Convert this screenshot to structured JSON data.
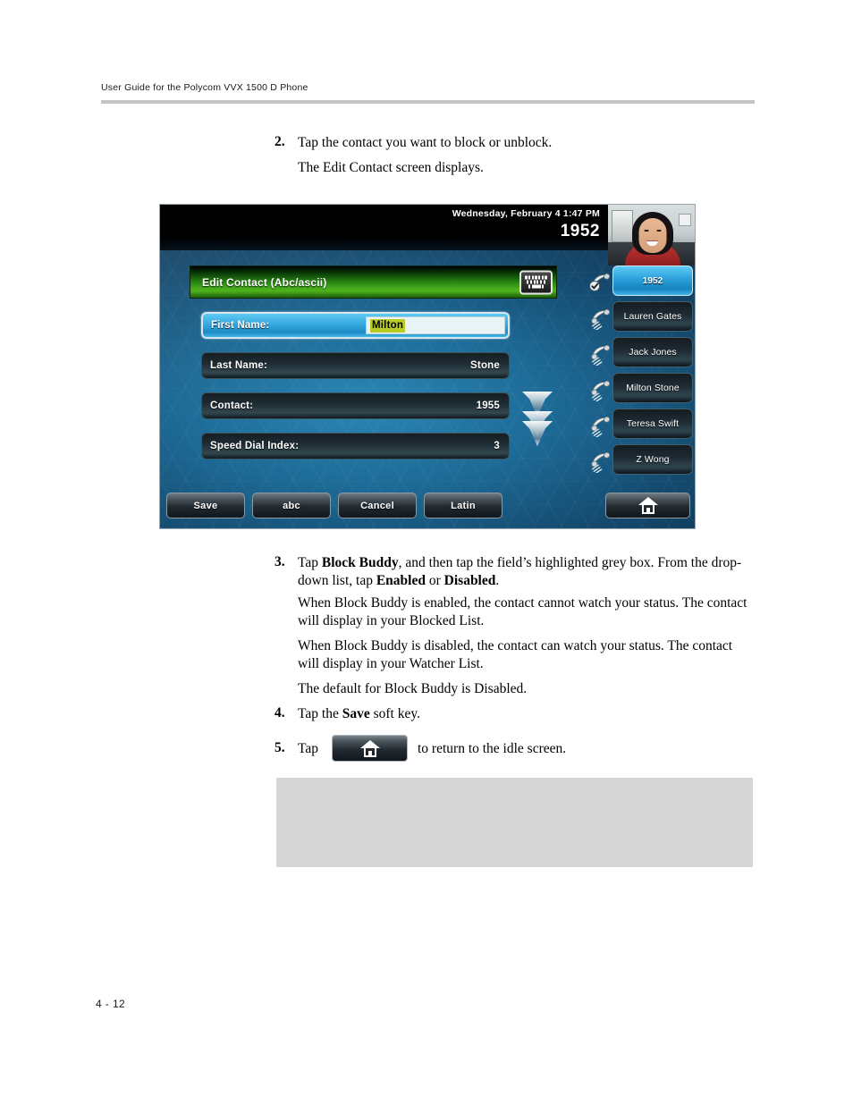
{
  "document": {
    "running_header": "User Guide for the Polycom VVX 1500 D Phone",
    "page_number": "4 - 12"
  },
  "steps": {
    "step2": {
      "number": "2.",
      "line1": "Tap the contact you want to block or unblock.",
      "line2": "The Edit Contact screen displays."
    },
    "step3": {
      "number": "3.",
      "text_a": "Tap ",
      "bold_a": "Block Buddy",
      "text_b": ", and then tap the field’s highlighted grey box. From the drop-down list, tap ",
      "bold_b": "Enabled",
      "text_c": " or ",
      "bold_c": "Disabled",
      "text_d": ".",
      "para1": "When Block Buddy is enabled, the contact cannot watch your status. The contact will display in your Blocked List.",
      "para2": "When Block Buddy is disabled, the contact can watch your status. The contact will display in your Watcher List.",
      "para3": "The default for Block Buddy is Disabled."
    },
    "step4": {
      "number": "4.",
      "text_a": "Tap the ",
      "bold_a": "Save",
      "text_b": " soft key."
    },
    "step5": {
      "number": "5.",
      "text_a": "Tap",
      "text_b": "to return to the idle screen.",
      "button_icon": "home-icon"
    }
  },
  "phone": {
    "status_bar": {
      "datetime": "Wednesday, February 4  1:47 PM",
      "extension": "1952"
    },
    "video_preview": {
      "icon": "video-self-view"
    },
    "title_bar": {
      "title": "Edit Contact (Abc/ascii)",
      "keyboard_icon": "keyboard-icon"
    },
    "fields": [
      {
        "label": "First Name:",
        "value": "Milton",
        "active": true,
        "editing": true
      },
      {
        "label": "Last Name:",
        "value": "Stone",
        "active": false,
        "editing": false
      },
      {
        "label": "Contact:",
        "value": "1955",
        "active": false,
        "editing": false
      },
      {
        "label": "Speed Dial Index:",
        "value": "3",
        "active": false,
        "editing": false
      }
    ],
    "scroll_indicator": "scroll-down-arrows",
    "line_keys": [
      {
        "label": "1952",
        "icon": "handset-registered-icon",
        "active": true
      },
      {
        "label": "Lauren Gates",
        "icon": "handset-icon",
        "active": false
      },
      {
        "label": "Jack Jones",
        "icon": "handset-icon",
        "active": false
      },
      {
        "label": "Milton Stone",
        "icon": "handset-icon",
        "active": false
      },
      {
        "label": "Teresa Swift",
        "icon": "handset-icon",
        "active": false
      },
      {
        "label": "Z Wong",
        "icon": "handset-icon",
        "active": false
      }
    ],
    "soft_keys": [
      {
        "label": "Save"
      },
      {
        "label": "abc"
      },
      {
        "label": "Cancel"
      },
      {
        "label": "Latin"
      }
    ],
    "home_key_icon": "home-icon"
  },
  "colors": {
    "title_bar_green": "#4fb51b",
    "active_field_blue": "#36a9e0",
    "selection_highlight": "#b8cc25",
    "header_rule": "#c4c4c4",
    "grey_box": "#d6d6d6"
  }
}
